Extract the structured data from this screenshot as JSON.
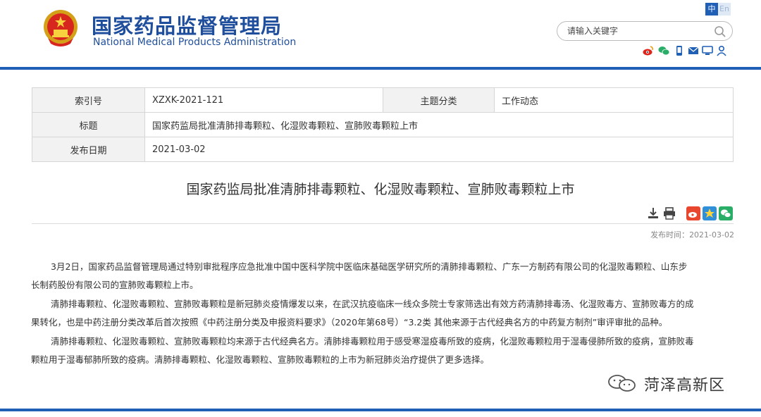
{
  "header": {
    "title_cn": "国家药品监督管理局",
    "title_en": "National Medical Products Administration",
    "lang_zh": "中",
    "lang_en": "En",
    "search_placeholder": "请输入关键字"
  },
  "social_icons": [
    "weibo-icon",
    "wechat-icon",
    "mobile-icon",
    "mail-icon",
    "message-icon",
    "user-icon"
  ],
  "info": {
    "index_label": "索引号",
    "index_value": "XZXK-2021-121",
    "category_label": "主题分类",
    "category_value": "工作动态",
    "title_label": "标题",
    "title_value": "国家药监局批准清肺排毒颗粒、化湿败毒颗粒、宣肺败毒颗粒上市",
    "date_label": "发布日期",
    "date_value": "2021-03-02"
  },
  "article": {
    "title": "国家药监局批准清肺排毒颗粒、化湿败毒颗粒、宣肺败毒颗粒上市",
    "pub_label": "发布时间：",
    "pub_date": "2021-03-02",
    "p1_line1": "3月2日，国家药品监督管理局通过特别审批程序应急批准中国中医科学院中医临床基础医学研究所的清肺排毒颗粒、广东一方制药有限公司的化湿败毒颗粒、山东步",
    "p1_line2": "长制药股份有限公司的宣肺败毒颗粒上市。",
    "p2_line1": "清肺排毒颗粒、化湿败毒颗粒、宣肺败毒颗粒是新冠肺炎疫情爆发以来，在武汉抗疫临床一线众多院士专家筛选出有效方药清肺排毒汤、化湿败毒方、宣肺败毒方的成",
    "p2_line2": "果转化，也是中药注册分类改革后首次按照《中药注册分类及申报资料要求》（2020年第68号）“3.2类 其他来源于古代经典名方的中药复方制剂”审评审批的品种。",
    "p3_line1": "清肺排毒颗粒、化湿败毒颗粒、宣肺败毒颗粒均来源于古代经典名方。清肺排毒颗粒用于感受寒湿疫毒所致的疫病，化湿败毒颗粒用于湿毒侵肺所致的疫病，宣肺败毒",
    "p3_line2": "颗粒用于湿毒郁肺所致的疫病。清肺排毒颗粒、化湿败毒颗粒、宣肺败毒颗粒的上市为新冠肺炎治疗提供了更多选择。"
  },
  "watermark": {
    "text": "菏泽高新区"
  },
  "colors": {
    "brand_blue": "#1f5fb5",
    "title_blue": "#1f4e9c"
  }
}
